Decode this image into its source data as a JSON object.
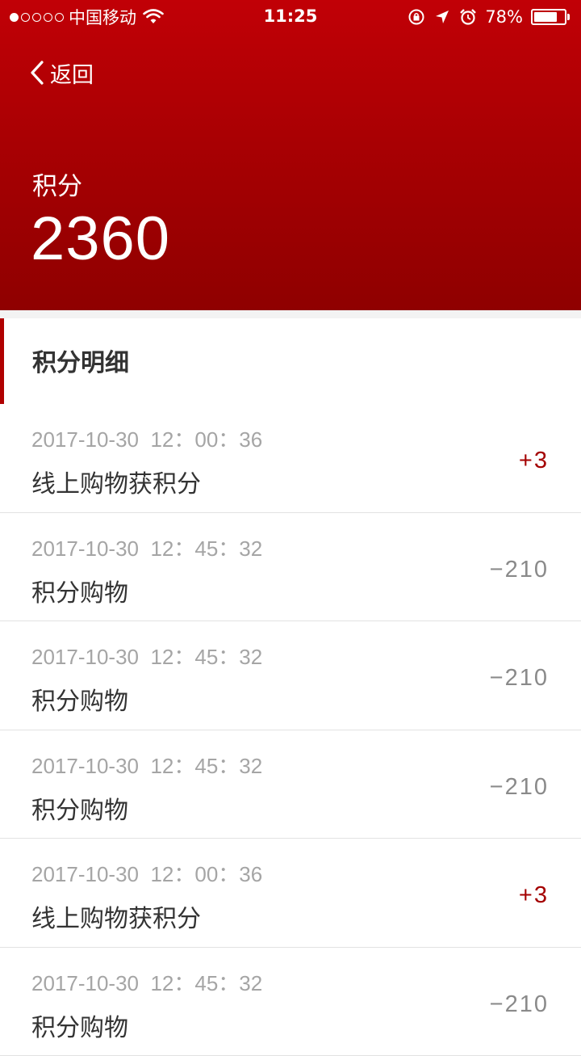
{
  "status_bar": {
    "carrier": "中国移动",
    "time": "11:25",
    "battery": "78%",
    "battery_level": 0.78
  },
  "header": {
    "back_label": "返回",
    "points_label": "积分",
    "points_value": "2360"
  },
  "section": {
    "title": "积分明细"
  },
  "records": [
    {
      "time": "2017-10-30  12：00：36",
      "desc": "线上购物获积分",
      "amount": "+3",
      "type": "plus"
    },
    {
      "time": "2017-10-30  12：45：32",
      "desc": "积分购物",
      "amount": "−210",
      "type": "minus"
    },
    {
      "time": "2017-10-30  12：45：32",
      "desc": "积分购物",
      "amount": "−210",
      "type": "minus"
    },
    {
      "time": "2017-10-30  12：45：32",
      "desc": "积分购物",
      "amount": "−210",
      "type": "minus"
    },
    {
      "time": "2017-10-30  12：00：36",
      "desc": "线上购物获积分",
      "amount": "+3",
      "type": "plus"
    },
    {
      "time": "2017-10-30  12：45：32",
      "desc": "积分购物",
      "amount": "−210",
      "type": "minus"
    }
  ],
  "colors": {
    "header_red": "#b00000",
    "plus_amount": "#a40000",
    "minus_amount": "#8a8a8a"
  }
}
